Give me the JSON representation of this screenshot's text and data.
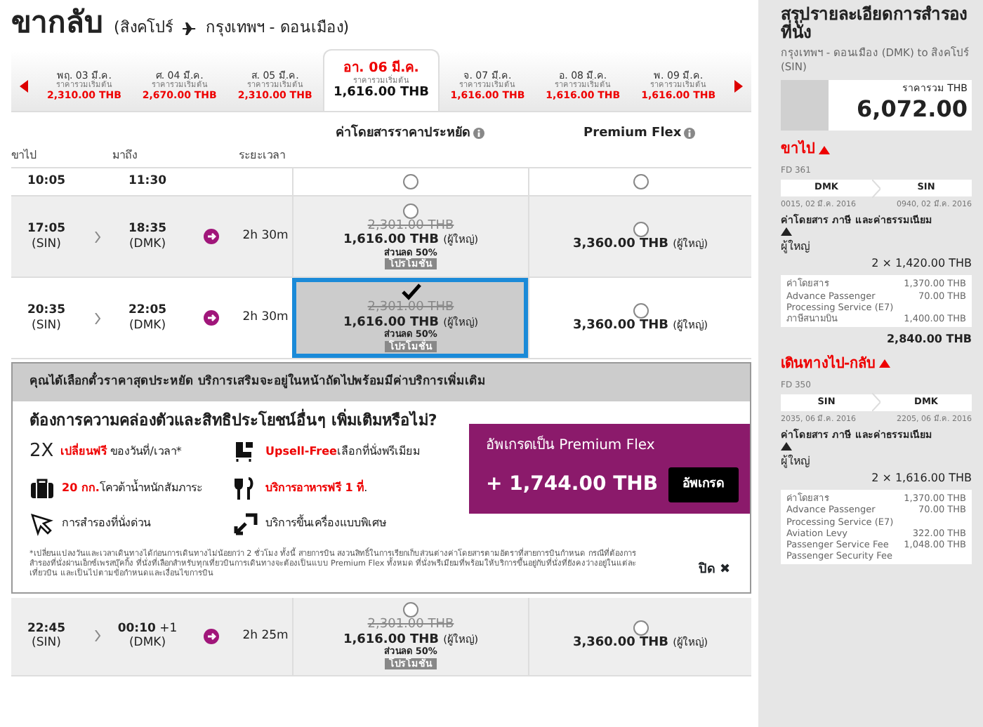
{
  "title": "ขากลับ",
  "route": {
    "origin": "(สิงคโปร์",
    "destination": "กรุงเทพฯ - ดอนเมือง)"
  },
  "dates": [
    {
      "day": "พฤ. 03 มี.ค.",
      "caption": "ราคารวมเริ่มต้น",
      "price": "2,310.00 THB",
      "selected": false
    },
    {
      "day": "ศ. 04 มี.ค.",
      "caption": "ราคารวมเริ่มต้น",
      "price": "2,670.00 THB",
      "selected": false
    },
    {
      "day": "ส. 05 มี.ค.",
      "caption": "ราคารวมเริ่มต้น",
      "price": "2,310.00 THB",
      "selected": false
    },
    {
      "day": "อา. 06 มี.ค.",
      "caption": "ราคารวมเริ่มต้น",
      "price": "1,616.00 THB",
      "selected": true
    },
    {
      "day": "จ. 07 มี.ค.",
      "caption": "ราคารวมเริ่มต้น",
      "price": "1,616.00 THB",
      "selected": false
    },
    {
      "day": "อ. 08 มี.ค.",
      "caption": "ราคารวมเริ่มต้น",
      "price": "1,616.00 THB",
      "selected": false
    },
    {
      "day": "พ. 09 มี.ค.",
      "caption": "ราคารวมเริ่มต้น",
      "price": "1,616.00 THB",
      "selected": false
    }
  ],
  "fare_headers": [
    "ค่าโดยสารราคาประหยัด",
    "Premium Flex"
  ],
  "columns": [
    "ขาไป",
    "มาถึง",
    "ระยะเวลา"
  ],
  "flights": [
    {
      "kind": "partial",
      "depart": "10:05",
      "arrive": "11:30",
      "fare": {
        "selected": false
      },
      "flex": {
        "selected": false
      }
    },
    {
      "kind": "full",
      "shade": true,
      "depart": "17:05",
      "depart_code": "(SIN)",
      "arrive": "18:35",
      "arrive_code": "(DMK)",
      "duration": "2h 30m",
      "fare": {
        "old_price": "2,301.00 THB",
        "price": "1,616.00 THB",
        "pax": "(ผู้ใหญ่)",
        "discount": "ส่วนลด 50%",
        "promo": "โปรโมชั่น",
        "selected": false
      },
      "flex": {
        "price": "3,360.00 THB",
        "pax": "(ผู้ใหญ่)",
        "selected": false
      }
    },
    {
      "kind": "full",
      "shade": false,
      "depart": "20:35",
      "depart_code": "(SIN)",
      "arrive": "22:05",
      "arrive_code": "(DMK)",
      "duration": "2h 30m",
      "fare": {
        "old_price": "2,301.00 THB",
        "price": "1,616.00 THB",
        "pax": "(ผู้ใหญ่)",
        "discount": "ส่วนลด 50%",
        "promo": "โปรโมชั่น",
        "selected": true
      },
      "flex": {
        "price": "3,360.00 THB",
        "pax": "(ผู้ใหญ่)",
        "selected": false
      }
    }
  ],
  "notice": {
    "header": "คุณได้เลือกตั๋วราคาสุดประหยัด บริการเสริมจะอยู่ในหน้าถัดไปพร้อมมีค่าบริการเพิ่มเติม",
    "question": "ต้องการความคล่องตัวและสิทธิประโยชน์อื่นๆ เพิ่มเติมหรือไม่?",
    "benefits": [
      {
        "kind": "badge",
        "badge": "2X",
        "highlight": "เปลี่ยนฟรี",
        "text": "ของวันที่/เวลา*"
      },
      {
        "kind": "seat",
        "highlight": "Upsell-Free",
        "text": "เลือกที่นั่งพรีเมียม"
      },
      {
        "kind": "bag",
        "highlight": "20 กก.",
        "text": "โควต้าน้ำหนักสัมภาระ"
      },
      {
        "kind": "meal",
        "highlight": "บริการอาหารฟรี 1 ที่",
        "text": "."
      },
      {
        "kind": "cursor",
        "text": "การสำรองที่นั่งด่วน"
      },
      {
        "kind": "boarding",
        "text": "บริการขึ้นเครื่องแบบพิเศษ"
      }
    ],
    "upgrade": {
      "label": "อัพเกรดเป็น Premium Flex",
      "price": "+ 1,744.00 THB",
      "button": "อัพเกรด"
    },
    "footnote": "*เปลี่ยนแปลงวันและเวลาเดินทางได้ก่อนการเดินทางไม่น้อยกว่า 2 ชั่วโมง ทั้งนี้ สายการบิน สงวนสิทธิ์ในการเรียกเก็บส่วนต่างค่าโดยสารตามอัตราที่สายการบินกำหนด กรณีที่ต้องการสำรองที่นั่งผ่านเอ็กซ์เพรสบุ๊คกิ้ง ที่นั่งที่เลือกสำหรับทุกเที่ยวบินการเดินทางจะต้องเป็นแบบ Premium Flex ทั้งหมด ที่นั่งพรีเมียมที่พร้อมให้บริการขึ้นอยู่กับที่นั่งที่ยังคงว่างอยู่ในแต่ละเที่ยวบิน และเป็นไปตามข้อกำหนดและเงื่อนไขการบิน",
    "close": {
      "label": "ปิด",
      "icon": "✖"
    }
  },
  "last_flight": {
    "depart": "22:45",
    "depart_code": "(SIN)",
    "arrive": "00:10",
    "arrive_note": "+1",
    "arrive_code": "(DMK)",
    "duration": "2h 25m",
    "fare": {
      "old_price": "2,301.00 THB",
      "price": "1,616.00 THB",
      "pax": "(ผู้ใหญ่)",
      "discount": "ส่วนลด 50%",
      "promo": "โปรโมชั่น",
      "selected": false
    },
    "flex": {
      "price": "3,360.00 THB",
      "pax": "(ผู้ใหญ่)",
      "selected": false
    }
  },
  "summary": {
    "title": "สรุปรายละเอียดการสำรองที่นั่ง",
    "route": "กรุงเทพฯ - ดอนเมือง (DMK) to สิงคโปร์ (SIN)",
    "total_label": "ราคารวม THB",
    "total": "6,072.00",
    "legs": [
      {
        "title": "ขาไป",
        "expanded": true,
        "flight": "FD 361",
        "from": "DMK",
        "to": "SIN",
        "from_time": "0015, 02 มี.ค. 2016",
        "to_time": "0940, 02 มี.ค. 2016",
        "fees_title": "ค่าโดยสาร ภาษี และค่าธรรมเนียม",
        "fees_expanded": true,
        "pax": "ผู้ใหญ่",
        "pax_total": "2 × 1,420.00 THB",
        "items": [
          {
            "label": "ค่าโดยสาร",
            "amount": "1,370.00 THB"
          },
          {
            "label": "Advance Passenger Processing Service (E7)",
            "amount": "70.00 THB"
          },
          {
            "label": "ภาษีสนามบิน",
            "amount": "1,400.00 THB"
          }
        ],
        "subtotal": "2,840.00 THB"
      },
      {
        "title": "เดินทางไป-กลับ",
        "expanded": true,
        "flight": "FD 350",
        "from": "SIN",
        "to": "DMK",
        "from_time": "2035, 06 มี.ค. 2016",
        "to_time": "2205, 06 มี.ค. 2016",
        "fees_title": "ค่าโดยสาร ภาษี และค่าธรรมเนียม",
        "fees_expanded": true,
        "pax": "ผู้ใหญ่",
        "pax_total": "2 × 1,616.00 THB",
        "items": [
          {
            "label": "ค่าโดยสาร",
            "amount": "1,370.00 THB"
          },
          {
            "label": "Advance Passenger Processing Service (E7)",
            "amount": "70.00 THB"
          },
          {
            "label": "Aviation Levy",
            "amount": "322.00 THB"
          },
          {
            "label": "Passenger Service Fee",
            "amount": "1,048.00 THB"
          },
          {
            "label": "Passenger Security Fee"
          }
        ]
      }
    ]
  }
}
